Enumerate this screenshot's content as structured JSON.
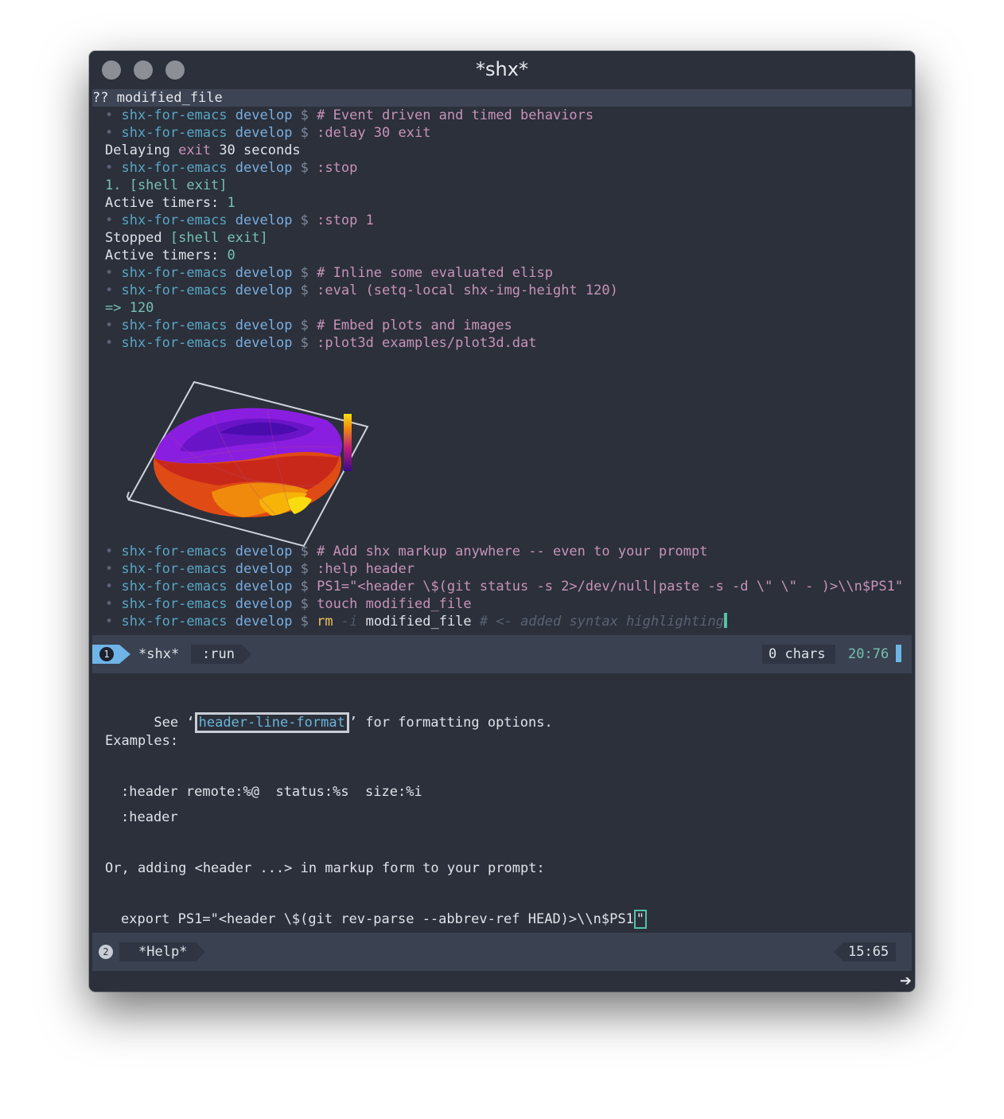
{
  "window": {
    "title": "*shx*",
    "traffic_lights": [
      "close",
      "minimize",
      "zoom"
    ]
  },
  "shell_pane": {
    "header_line": "?? modified_file",
    "prompt": {
      "bullet": "•",
      "dir": "shx-for-emacs",
      "branch": "develop",
      "sign": "$"
    },
    "lines": [
      {
        "kind": "prompt",
        "cmd": "# Event driven and timed behaviors"
      },
      {
        "kind": "prompt",
        "cmd": ":delay 30 exit"
      },
      {
        "kind": "output",
        "parts": [
          [
            "Delaying ",
            "wh"
          ],
          [
            "exit",
            "cmd"
          ],
          [
            " 30 seconds",
            "wh"
          ]
        ]
      },
      {
        "kind": "prompt",
        "cmd": ":stop"
      },
      {
        "kind": "output",
        "parts": [
          [
            "1. [shell exit]",
            "cyan"
          ]
        ]
      },
      {
        "kind": "output",
        "parts": [
          [
            "Active timers: ",
            "wh"
          ],
          [
            "1",
            "cyan"
          ]
        ]
      },
      {
        "kind": "prompt",
        "cmd": ":stop 1"
      },
      {
        "kind": "output",
        "parts": [
          [
            "Stopped ",
            "wh"
          ],
          [
            "[shell exit]",
            "cyan"
          ]
        ]
      },
      {
        "kind": "output",
        "parts": [
          [
            "Active timers: ",
            "wh"
          ],
          [
            "0",
            "cyan"
          ]
        ]
      },
      {
        "kind": "prompt",
        "cmd": "# Inline some evaluated elisp"
      },
      {
        "kind": "prompt",
        "cmd": ":eval (setq-local shx-img-height 120)"
      },
      {
        "kind": "output",
        "parts": [
          [
            "=> 120",
            "cyan"
          ]
        ]
      },
      {
        "kind": "prompt",
        "cmd": "# Embed plots and images"
      },
      {
        "kind": "prompt",
        "cmd": ":plot3d examples/plot3d.dat"
      },
      {
        "kind": "image"
      },
      {
        "kind": "prompt",
        "cmd": "# Add shx markup anywhere -- even to your prompt"
      },
      {
        "kind": "prompt",
        "cmd": ":help header"
      },
      {
        "kind": "prompt",
        "cmd": "PS1=\"<header \\$(git status -s 2>/dev/null|paste -s -d \\\" \\\" - )>\\\\n$PS1\""
      },
      {
        "kind": "prompt",
        "cmd": "touch modified_file"
      },
      {
        "kind": "last"
      }
    ],
    "last_line": {
      "rm": "rm",
      "flag": "-i",
      "file": "modified_file",
      "comment": "# <- added syntax highlighting"
    }
  },
  "modeline_1": {
    "window_number": "1",
    "buffer_name": "*shx*",
    "mode": ":run",
    "chars": "0 chars",
    "position": "20:76"
  },
  "help_pane": {
    "see": "See ‘",
    "link": "header-line-format",
    "see_rest": "’ for formatting options.",
    "examples_label": "Examples:",
    "example1": ":header remote:%@  status:%s  size:%i",
    "example2": ":header",
    "or_line": "Or, adding <header ...> in markup form to your prompt:",
    "export_line": "export PS1=\"<header \\$(git rev-parse --abbrev-ref HEAD)>\\\\n$PS1",
    "export_close": "\""
  },
  "modeline_2": {
    "window_number": "2",
    "buffer_name": "*Help*",
    "position": "15:65"
  },
  "minibuffer": {
    "indicator_icon": "arrow-right-icon",
    "glyph": "➔"
  },
  "colors": {
    "background": "#2b303b",
    "modeline": "#3a4150",
    "prompt_dir": "#5aa6c2",
    "prompt_branch": "#7aaee0",
    "command": "#c893b8",
    "cursor": "#56c2a2",
    "window_badge": "#6fb4e6"
  }
}
